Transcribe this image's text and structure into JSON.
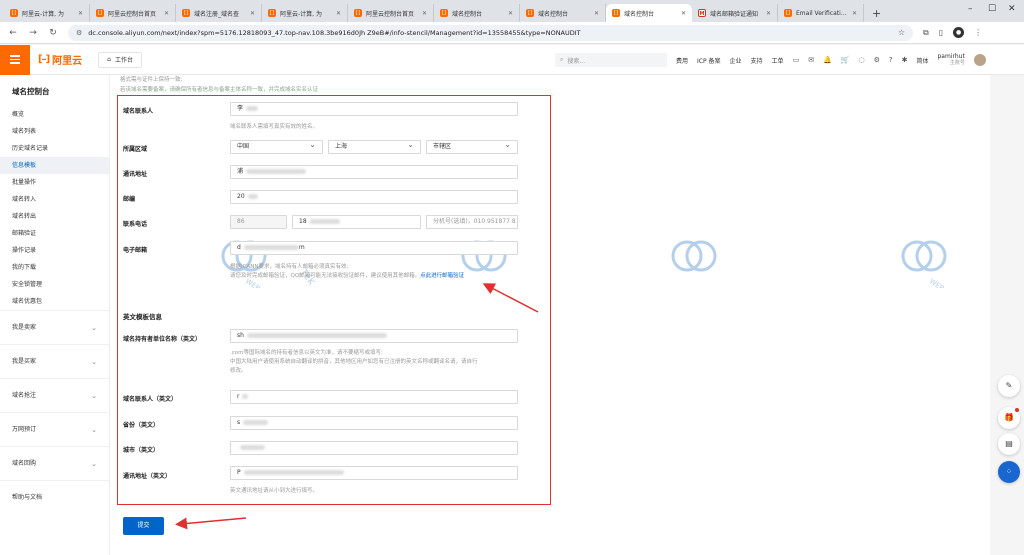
{
  "browser": {
    "tabs": [
      {
        "label": "阿里云-计算, 为",
        "icon": "aliyun"
      },
      {
        "label": "阿里云控制台首页",
        "icon": "aliyun"
      },
      {
        "label": "域名注册_域名查",
        "icon": "aliyun"
      },
      {
        "label": "阿里云-计算, 为",
        "icon": "aliyun"
      },
      {
        "label": "阿里云控制台首页",
        "icon": "aliyun"
      },
      {
        "label": "域名控制台",
        "icon": "aliyun"
      },
      {
        "label": "域名控制台",
        "icon": "aliyun"
      },
      {
        "label": "域名控制台",
        "icon": "aliyun",
        "active": true
      },
      {
        "label": "域名邮箱验证通知",
        "icon": "gmail"
      },
      {
        "label": "Email Verification",
        "icon": "aliyun"
      }
    ],
    "new_tab": "+",
    "url": "dc.console.aliyun.com/next/index?spm=5176.12818093_47.top-nav.108.3be916d0Jh Z9eB#/info-stencil/Management?id=13558455&type=NONAUDIT"
  },
  "header": {
    "logo_text": "阿里云",
    "workbench": "工作台",
    "search_placeholder": "搜索...",
    "nav": [
      "费用",
      "ICP 备案",
      "企业",
      "支持",
      "工单"
    ],
    "lang": "简体",
    "user_name": "pamirhut",
    "user_sub": "主账号"
  },
  "sidebar": {
    "title": "域名控制台",
    "items": [
      "概览",
      "域名列表",
      "历史域名记录",
      "信息模板",
      "批量操作",
      "域名转入",
      "域名转出",
      "邮箱验证",
      "操作记录",
      "我的下载",
      "安全锁管理",
      "域名优惠包"
    ],
    "active_index": 3,
    "groups": [
      "我是卖家",
      "我是买家",
      "域名抢注",
      "万网预订",
      "域名回购",
      "帮助与文档"
    ]
  },
  "form": {
    "top_notes": [
      "格式需与证件上保持一致;",
      "若该域名需要备案，请确保所有者信息与备案主体名称一致，并完成域名实名认证"
    ],
    "contact_label": "域名联系人",
    "contact_value": "李",
    "contact_hint": "域名联系人需填写真实有效的姓名。",
    "region_label": "所属区域",
    "region_country": "中国",
    "region_province": "上海",
    "region_district": "市辖区",
    "address_label": "通讯地址",
    "address_value": "浦",
    "postcode_label": "邮编",
    "postcode_value": "20",
    "phone_label": "联系电话",
    "phone_code": "86",
    "phone_value": "18",
    "phone_ext_placeholder": "分机号(选填)，010 951877 8",
    "email_label": "电子邮箱",
    "email_prefix": "d",
    "email_suffix": "m",
    "email_hint_1": "根据ICANN要求，域名持有人邮箱必须真实有效;",
    "email_hint_2": "请您及时完成邮箱验证，QQ邮箱可能无法接收验证邮件，建议使用其他邮箱。",
    "email_verify_link": "点此进行邮箱验证",
    "en_section": "英文模板信息",
    "en_owner_label": "域名持有者单位名称（英文）",
    "en_owner_value": "sh",
    "en_owner_hint_1": ".com等国际域名的持有者信息以英文为准，请不要缩写或填写;",
    "en_owner_hint_2": "中国大陆用户请使用系统自动翻译的拼音，其他地区用户如您有已注册的英文名称或翻译名请，请自行",
    "en_owner_hint_3": "修改。",
    "en_contact_label": "域名联系人（英文）",
    "en_contact_value": "r",
    "en_province_label": "省份（英文）",
    "en_province_value": "s",
    "en_city_label": "城市（英文）",
    "en_city_value": "",
    "en_address_label": "通讯地址（英文）",
    "en_address_value": "P",
    "en_address_hint": "英文通讯地址请从小到大进行填写。",
    "submit_label": "提交"
  },
  "colors": {
    "brand_orange": "#ff6a00",
    "primary_blue": "#0064c8",
    "highlight_red": "#e03030"
  }
}
